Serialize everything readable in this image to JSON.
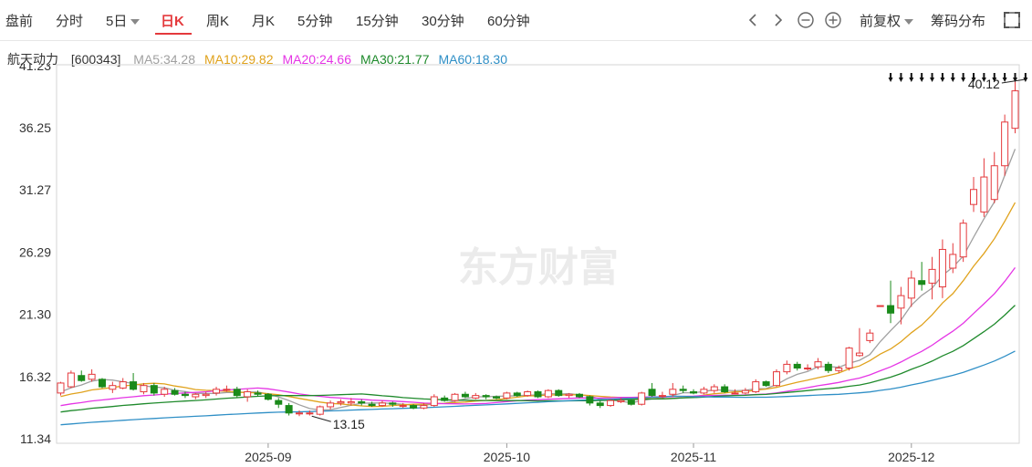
{
  "toolbar": {
    "tabs": [
      "盘前",
      "分时",
      "5日",
      "日K",
      "周K",
      "月K",
      "5分钟",
      "15分钟",
      "30分钟",
      "60分钟"
    ],
    "active_tab": "日K",
    "adjust_label": "前复权",
    "chip_label": "筹码分布"
  },
  "stock": {
    "name": "航天动力",
    "code": "[600343]"
  },
  "ma_legend": [
    {
      "label": "MA5:34.28",
      "color": "#a0a0a0"
    },
    {
      "label": "MA10:29.82",
      "color": "#e0a21c"
    },
    {
      "label": "MA20:24.66",
      "color": "#e535e5"
    },
    {
      "label": "MA30:21.77",
      "color": "#1f8a2c"
    },
    {
      "label": "MA60:18.30",
      "color": "#2f8fc6"
    }
  ],
  "watermark": "东方财富",
  "colors": {
    "up": "#e4393c",
    "down": "#1a8a1a"
  },
  "chart_data": {
    "type": "candlestick",
    "y_ticks": [
      "41.23",
      "36.25",
      "31.27",
      "26.29",
      "21.30",
      "16.32",
      "11.34"
    ],
    "ylim": [
      11.34,
      41.23
    ],
    "x_ticks": [
      {
        "label": "2025-09",
        "index": 20
      },
      {
        "label": "2025-10",
        "index": 43
      },
      {
        "label": "2025-11",
        "index": 61
      },
      {
        "label": "2025-12",
        "index": 82
      }
    ],
    "annotations": [
      {
        "label": "40.12",
        "index": 93,
        "value": 40.12
      },
      {
        "label": "13.15",
        "index": 25,
        "value": 13.15
      }
    ],
    "limit_up_markers_start": 80,
    "limit_up_markers_count": 14,
    "candles": [
      [
        15.0,
        15.8,
        15.9,
        14.8
      ],
      [
        15.5,
        16.6,
        16.8,
        15.4
      ],
      [
        16.4,
        16.0,
        16.8,
        15.9
      ],
      [
        16.1,
        16.5,
        16.9,
        15.9
      ],
      [
        16.1,
        15.5,
        16.2,
        15.4
      ],
      [
        15.3,
        15.6,
        15.9,
        15.0
      ],
      [
        15.4,
        15.9,
        16.2,
        15.3
      ],
      [
        15.9,
        15.3,
        16.6,
        15.2
      ],
      [
        15.1,
        15.6,
        15.8,
        14.9
      ],
      [
        15.6,
        15.0,
        15.8,
        14.8
      ],
      [
        14.9,
        15.3,
        15.5,
        14.7
      ],
      [
        15.2,
        14.9,
        15.4,
        14.8
      ],
      [
        14.9,
        14.8,
        15.1,
        14.6
      ],
      [
        14.7,
        14.9,
        15.0,
        14.5
      ],
      [
        14.8,
        14.9,
        15.1,
        14.6
      ],
      [
        15.0,
        15.3,
        15.5,
        14.8
      ],
      [
        15.3,
        15.3,
        15.6,
        15.1
      ],
      [
        15.3,
        14.8,
        15.5,
        14.6
      ],
      [
        14.7,
        15.1,
        15.3,
        14.3
      ],
      [
        15.0,
        14.9,
        15.2,
        14.7
      ],
      [
        14.9,
        14.5,
        15.0,
        14.4
      ],
      [
        14.4,
        14.1,
        14.6,
        13.8
      ],
      [
        14.0,
        13.4,
        14.2,
        13.2
      ],
      [
        13.4,
        13.4,
        13.6,
        13.15
      ],
      [
        13.4,
        13.4,
        13.6,
        13.2
      ],
      [
        13.3,
        13.9,
        14.0,
        13.2
      ],
      [
        13.9,
        14.2,
        14.4,
        13.7
      ],
      [
        14.2,
        14.3,
        14.5,
        14.0
      ],
      [
        14.2,
        14.3,
        14.6,
        14.0
      ],
      [
        14.3,
        14.2,
        14.5,
        14.0
      ],
      [
        14.1,
        14.0,
        14.3,
        13.9
      ],
      [
        14.0,
        14.2,
        14.4,
        13.9
      ],
      [
        14.2,
        14.1,
        14.3,
        13.9
      ],
      [
        14.0,
        14.0,
        14.2,
        13.8
      ],
      [
        14.0,
        13.8,
        14.1,
        13.7
      ],
      [
        13.8,
        14.0,
        14.2,
        13.7
      ],
      [
        14.0,
        14.7,
        14.9,
        13.9
      ],
      [
        14.6,
        14.4,
        14.8,
        14.3
      ],
      [
        14.4,
        14.9,
        15.0,
        14.3
      ],
      [
        14.9,
        14.7,
        15.1,
        14.6
      ],
      [
        14.6,
        14.8,
        15.0,
        14.5
      ],
      [
        14.8,
        14.7,
        14.9,
        14.5
      ],
      [
        14.7,
        14.6,
        14.8,
        14.5
      ],
      [
        14.6,
        15.0,
        15.1,
        14.5
      ],
      [
        15.0,
        14.8,
        15.1,
        14.7
      ],
      [
        14.8,
        15.1,
        15.2,
        14.7
      ],
      [
        15.1,
        14.7,
        15.2,
        14.6
      ],
      [
        14.7,
        15.2,
        15.3,
        14.6
      ],
      [
        15.2,
        14.8,
        15.3,
        14.7
      ],
      [
        14.8,
        14.9,
        15.0,
        14.6
      ],
      [
        14.9,
        14.7,
        15.0,
        14.6
      ],
      [
        14.7,
        14.2,
        14.8,
        14.0
      ],
      [
        14.2,
        14.0,
        14.4,
        13.8
      ],
      [
        14.0,
        14.4,
        14.5,
        13.9
      ],
      [
        14.3,
        14.4,
        14.6,
        14.2
      ],
      [
        14.4,
        14.1,
        14.5,
        14.0
      ],
      [
        14.1,
        15.0,
        15.1,
        14.0
      ],
      [
        15.3,
        14.8,
        15.8,
        14.7
      ],
      [
        14.8,
        14.8,
        15.1,
        14.6
      ],
      [
        14.9,
        15.3,
        15.8,
        14.7
      ],
      [
        15.3,
        15.2,
        15.6,
        15.0
      ],
      [
        15.1,
        15.0,
        15.3,
        14.9
      ],
      [
        15.0,
        15.3,
        15.5,
        14.9
      ],
      [
        15.2,
        15.5,
        15.7,
        15.0
      ],
      [
        15.5,
        15.1,
        15.7,
        15.0
      ],
      [
        15.0,
        15.0,
        15.3,
        14.9
      ],
      [
        15.0,
        15.2,
        15.4,
        14.9
      ],
      [
        15.1,
        15.9,
        16.1,
        15.0
      ],
      [
        15.9,
        15.6,
        16.0,
        15.5
      ],
      [
        15.6,
        16.7,
        16.9,
        15.5
      ],
      [
        16.7,
        17.3,
        17.6,
        16.5
      ],
      [
        17.3,
        17.0,
        17.5,
        16.8
      ],
      [
        17.0,
        17.0,
        17.3,
        16.8
      ],
      [
        17.1,
        17.5,
        17.8,
        16.9
      ],
      [
        17.3,
        16.8,
        17.5,
        16.6
      ],
      [
        16.8,
        17.0,
        17.2,
        16.6
      ],
      [
        17.0,
        18.6,
        18.7,
        16.8
      ],
      [
        18.0,
        18.2,
        20.2,
        17.9
      ],
      [
        19.2,
        19.8,
        20.1,
        19.0
      ],
      [
        22.0,
        22.0,
        22.0,
        22.0
      ],
      [
        22.0,
        21.4,
        24.0,
        20.6
      ],
      [
        21.8,
        22.8,
        23.5,
        20.5
      ],
      [
        22.6,
        24.2,
        24.8,
        21.9
      ],
      [
        24.0,
        23.7,
        25.5,
        23.2
      ],
      [
        23.8,
        24.9,
        25.9,
        22.5
      ],
      [
        23.5,
        26.5,
        27.3,
        22.6
      ],
      [
        25.0,
        26.1,
        27.0,
        24.6
      ],
      [
        25.9,
        28.6,
        28.9,
        25.5
      ],
      [
        30.1,
        31.3,
        32.3,
        29.5
      ],
      [
        29.5,
        32.3,
        33.8,
        29.1
      ],
      [
        30.5,
        33.2,
        34.3,
        30.2
      ],
      [
        33.2,
        36.7,
        37.3,
        32.4
      ],
      [
        36.2,
        39.2,
        40.12,
        35.8
      ]
    ]
  }
}
